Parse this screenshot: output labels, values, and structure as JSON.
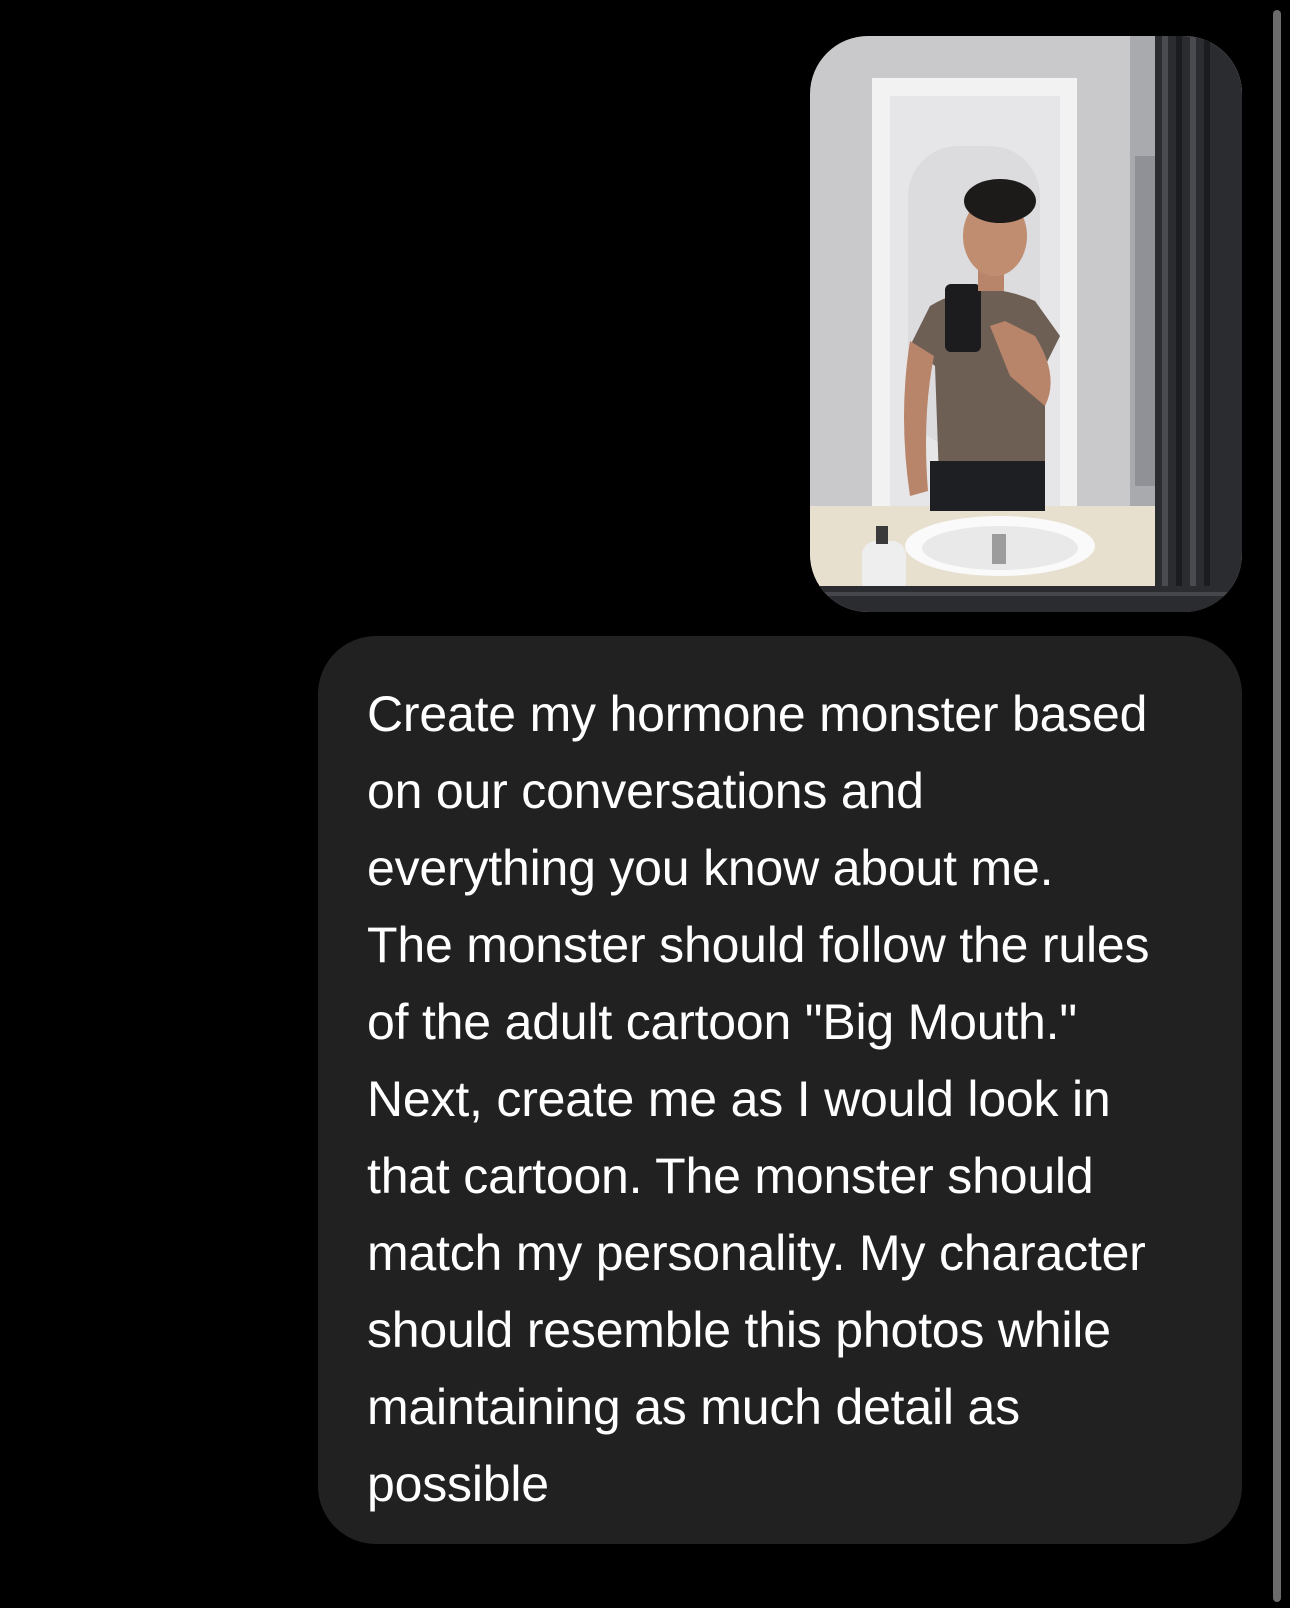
{
  "conversation": {
    "attachment": {
      "kind": "photo",
      "icon": "photo-attachment"
    },
    "message": {
      "text": "Create my hormone monster based\non our conversations and\neverything you know about me.\nThe monster should follow the rules\nof the adult cartoon \"Big Mouth.\"\nNext, create me as I would look in\nthat cartoon. The monster should\nmatch my personality. My character\nshould resemble this photos while\nmaintaining as much detail as\npossible"
    }
  },
  "colors": {
    "background": "#000000",
    "bubble": "#212121",
    "text": "#ffffff",
    "scrollbar": "#6b6b6b"
  }
}
